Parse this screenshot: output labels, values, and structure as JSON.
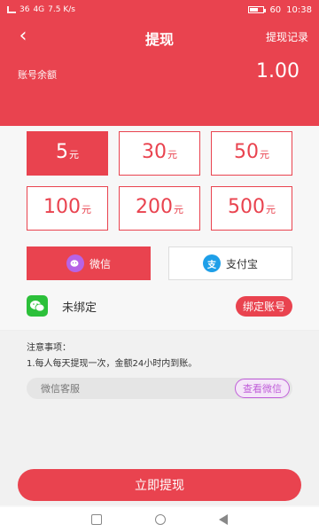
{
  "status": {
    "left_text_1": "36",
    "left_text_2": "4G",
    "speed": "7.5 K/s",
    "battery_pct": "60",
    "time": "10:38"
  },
  "nav": {
    "title": "提现",
    "right": "提现记录"
  },
  "balance": {
    "label": "账号余额",
    "value": "1.00"
  },
  "amounts": [
    {
      "num": "5",
      "unit": "元",
      "active": true
    },
    {
      "num": "30",
      "unit": "元"
    },
    {
      "num": "50",
      "unit": "元"
    },
    {
      "num": "100",
      "unit": "元"
    },
    {
      "num": "200",
      "unit": "元"
    },
    {
      "num": "500",
      "unit": "元"
    }
  ],
  "pay": {
    "wechat": "微信",
    "alipay": "支付宝",
    "alipay_glyph": "支"
  },
  "bind": {
    "status": "未绑定",
    "button": "绑定账号"
  },
  "notice": {
    "title": "注意事项：",
    "line1": "1.每人每天提现一次，金额24小时内到账。"
  },
  "service": {
    "label": "微信客服",
    "button": "查看微信"
  },
  "submit": "立即提现",
  "colors": {
    "primary": "#e9434f",
    "wechat_green": "#2cc03a",
    "alipay_blue": "#1e9fe8",
    "service_purple": "#c05ed9"
  }
}
